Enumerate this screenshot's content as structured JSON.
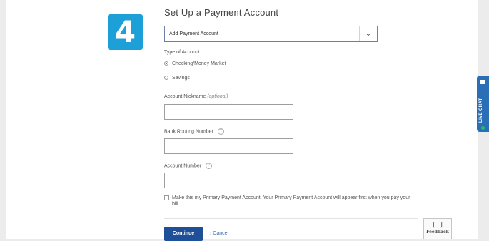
{
  "step": {
    "number": "4"
  },
  "title": "Set Up a Payment Account",
  "account_select": {
    "value": "Add Payment Account",
    "chevron": "⌄"
  },
  "account_type": {
    "label": "Type of Account:",
    "options": [
      {
        "label": "Checking/Money Market",
        "selected": true
      },
      {
        "label": "Savings",
        "selected": false
      }
    ]
  },
  "fields": {
    "nickname": {
      "label": "Account Nickname",
      "optional": "(optional)",
      "value": ""
    },
    "routing": {
      "label": "Bank Routing Number",
      "help": "?",
      "value": ""
    },
    "account": {
      "label": "Account Number",
      "help": "?",
      "value": ""
    }
  },
  "primary_checkbox": {
    "checked": false,
    "text": "Make this my Primary Payment Account. Your Primary Payment Account will appear first when you pay your bill."
  },
  "actions": {
    "continue": "Continue",
    "cancel": "› Cancel"
  },
  "feedback": {
    "icon": "[–]",
    "label": "Feedback"
  },
  "live_chat": {
    "label": "LIVE CHAT"
  },
  "colors": {
    "badge": "#1d9fd8",
    "primary_button": "#1f4f96",
    "link": "#3f6fb2",
    "live_chat": "#2a6fb5",
    "online_dot": "#27c15a"
  }
}
